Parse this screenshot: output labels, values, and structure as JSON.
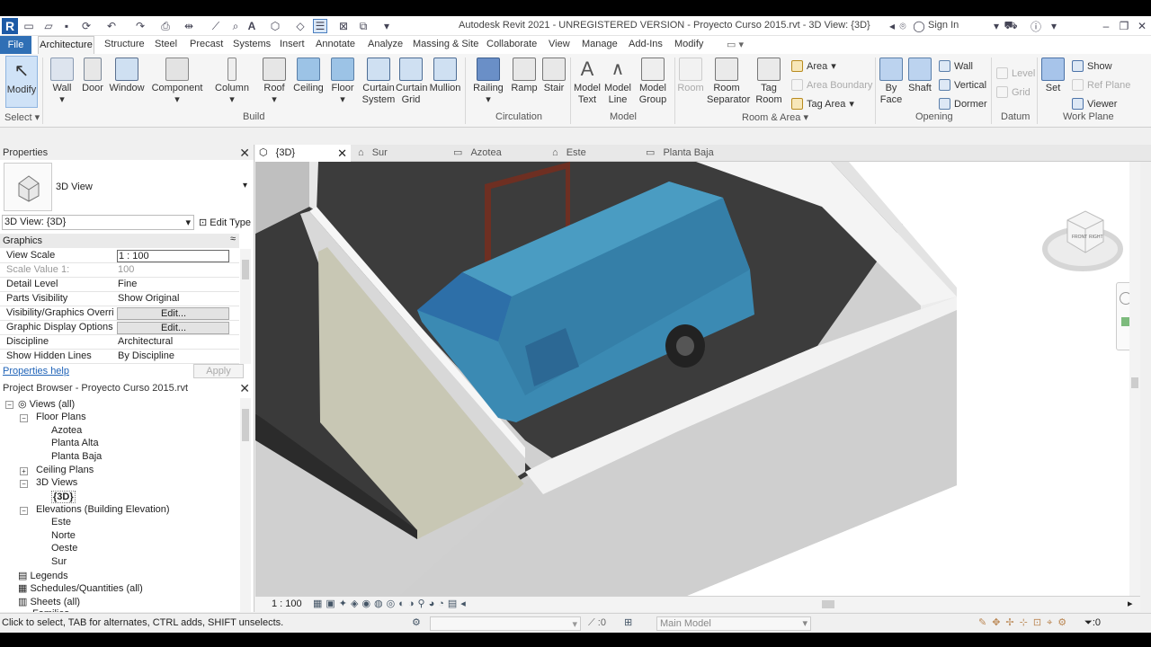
{
  "title": "Autodesk Revit 2021 - UNREGISTERED VERSION - Proyecto Curso 2015.rvt - 3D View: {3D}",
  "sign_in": "Sign In",
  "menu_tabs": [
    "File",
    "Architecture",
    "Structure",
    "Steel",
    "Precast",
    "Systems",
    "Insert",
    "Annotate",
    "Analyze",
    "Massing & Site",
    "Collaborate",
    "View",
    "Manage",
    "Add-Ins",
    "Modify"
  ],
  "ribbon": {
    "modify": "Modify",
    "select": "Select",
    "build": [
      "Wall",
      "Door",
      "Window",
      "Component",
      "Column",
      "Roof",
      "Ceiling",
      "Floor",
      "Curtain System",
      "Curtain Grid",
      "Mullion"
    ],
    "circulation": [
      "Railing",
      "Ramp",
      "Stair"
    ],
    "model": [
      "Model Text",
      "Model Line",
      "Model Group"
    ],
    "room": [
      "Room",
      "Room Separator",
      "Tag Room"
    ],
    "room_small": [
      "Area",
      "Area Boundary",
      "Tag Area"
    ],
    "opening": [
      "By Face",
      "Shaft"
    ],
    "opening_small": [
      "Wall",
      "Vertical",
      "Dormer"
    ],
    "datum": [
      "Level",
      "Grid"
    ],
    "workplane": [
      "Set"
    ],
    "workplane_small": [
      "Show",
      "Ref Plane",
      "Viewer"
    ],
    "groups": {
      "build": "Build",
      "circulation": "Circulation",
      "model": "Model",
      "room": "Room & Area",
      "opening": "Opening",
      "datum": "Datum",
      "workplane": "Work Plane"
    }
  },
  "properties": {
    "title": "Properties",
    "type_name": "3D View",
    "selector": "3D View: {3D}",
    "edit_type": "Edit Type",
    "section": "Graphics",
    "rows": [
      {
        "k": "View Scale",
        "v": "1 : 100"
      },
      {
        "k": "Scale Value    1:",
        "v": "100"
      },
      {
        "k": "Detail Level",
        "v": "Fine"
      },
      {
        "k": "Parts Visibility",
        "v": "Show Original"
      },
      {
        "k": "Visibility/Graphics Overri...",
        "v": "Edit..."
      },
      {
        "k": "Graphic Display Options",
        "v": "Edit..."
      },
      {
        "k": "Discipline",
        "v": "Architectural"
      },
      {
        "k": "Show Hidden Lines",
        "v": "By Discipline"
      }
    ],
    "help": "Properties help",
    "apply": "Apply"
  },
  "browser": {
    "title": "Project Browser - Proyecto Curso 2015.rvt",
    "items": [
      "Views (all)",
      "Floor Plans",
      "Azotea",
      "Planta Alta",
      "Planta Baja",
      "Ceiling Plans",
      "3D Views",
      "{3D}",
      "Elevations (Building Elevation)",
      "Este",
      "Norte",
      "Oeste",
      "Sur",
      "Legends",
      "Schedules/Quantities (all)",
      "Sheets (all)",
      "Families"
    ]
  },
  "view_tabs": [
    "{3D}",
    "Sur",
    "Azotea",
    "Este",
    "Planta Baja"
  ],
  "viewcube": {
    "front": "FRONT",
    "right": "RIGHT"
  },
  "view_scale": "1 : 100",
  "status": {
    "hint": "Click to select, TAB for alternates, CTRL adds, SHIFT unselects.",
    "sel_count": ":0",
    "model": "Main Model",
    "filter": ":0"
  },
  "colors": {
    "accent": "#2f6fb5",
    "car": "#3d8fb5",
    "wall": "#dcdcdc",
    "floor": "#3a3a3a"
  }
}
